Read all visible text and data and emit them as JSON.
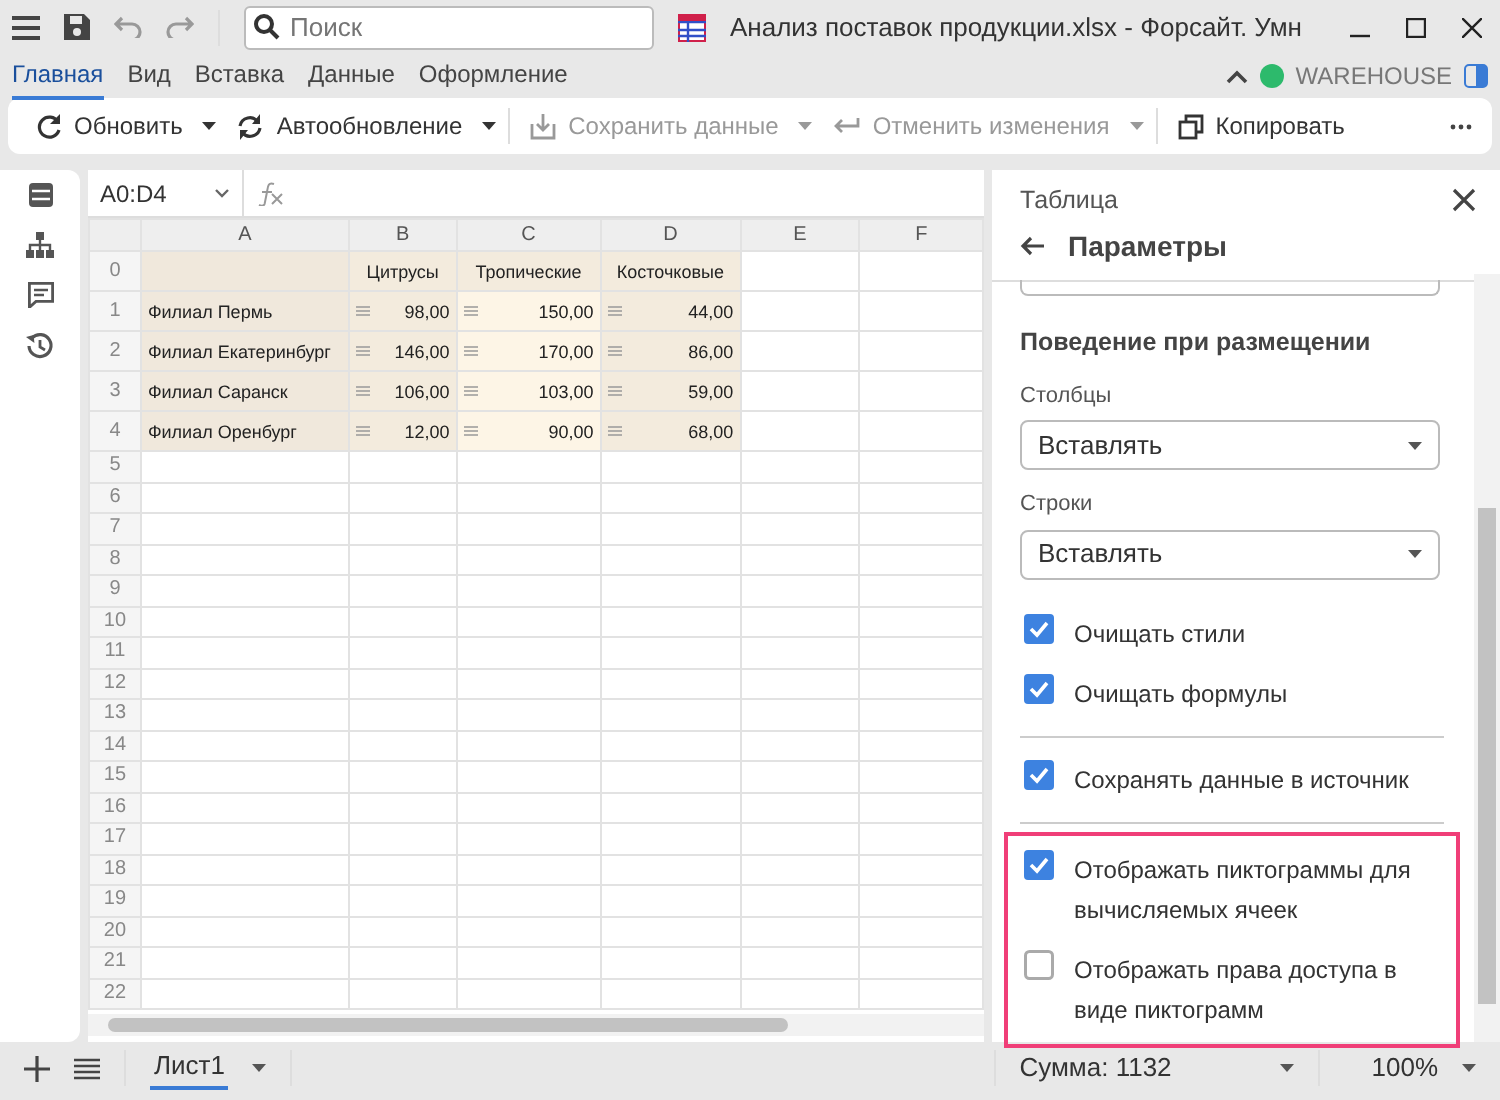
{
  "window": {
    "title": "Анализ поставок продукции.xlsx - Форсайт. Умн",
    "search_placeholder": "Поиск"
  },
  "ribbon_tabs": [
    {
      "label": "Главная",
      "selected": true
    },
    {
      "label": "Вид",
      "selected": false
    },
    {
      "label": "Вставка",
      "selected": false
    },
    {
      "label": "Данные",
      "selected": false
    },
    {
      "label": "Оформление",
      "selected": false
    }
  ],
  "connection": {
    "name": "WAREHOUSE",
    "color": "#2dba6c"
  },
  "toolbar": [
    {
      "kind": "refresh",
      "label": "Обновить",
      "dropdown": true,
      "disabled": false
    },
    {
      "kind": "autorefresh",
      "label": "Автообновление",
      "dropdown": true,
      "disabled": false
    },
    {
      "kind": "save",
      "label": "Сохранить данные",
      "dropdown": true,
      "disabled": true
    },
    {
      "kind": "undo",
      "label": "Отменить изменения",
      "dropdown": true,
      "disabled": true
    },
    {
      "kind": "copy",
      "label": "Копировать",
      "dropdown": false,
      "disabled": false
    }
  ],
  "formula_bar": {
    "cell_ref": "A0:D4"
  },
  "sheet": {
    "columns": [
      "A",
      "B",
      "C",
      "D",
      "E",
      "F"
    ],
    "row_numbers": [
      "0",
      "1",
      "2",
      "3",
      "4",
      "5",
      "6",
      "7",
      "8",
      "9",
      "10",
      "11",
      "12",
      "13",
      "14",
      "15",
      "16",
      "17",
      "18",
      "19",
      "20",
      "21",
      "22"
    ],
    "header": [
      "Цитрусы",
      "Тропические",
      "Косточковые"
    ],
    "rows": [
      [
        "Филиал Пермь",
        "98,00",
        "150,00",
        "44,00"
      ],
      [
        "Филиал Екатеринбург",
        "146,00",
        "170,00",
        "86,00"
      ],
      [
        "Филиал Саранск",
        "106,00",
        "103,00",
        "59,00"
      ],
      [
        "Филиал Оренбург",
        "12,00",
        "90,00",
        "68,00"
      ]
    ]
  },
  "panel": {
    "context": "Таблица",
    "title": "Параметры",
    "section": "Поведение при размещении",
    "selects": [
      {
        "label": "Столбцы",
        "value": "Вставлять"
      },
      {
        "label": "Строки",
        "value": "Вставлять"
      }
    ],
    "groups": [
      {
        "highlighted": false,
        "options": [
          {
            "label": "Очищать стили",
            "checked": true
          },
          {
            "label": "Очищать формулы",
            "checked": true
          }
        ]
      },
      {
        "highlighted": false,
        "options": [
          {
            "label": "Сохранять данные в источник",
            "checked": true
          }
        ]
      },
      {
        "highlighted": true,
        "options": [
          {
            "label": "Отображать пиктограммы для вычисляемых ячеек",
            "checked": true
          },
          {
            "label": "Отображать права доступа в виде пиктограмм",
            "checked": false
          }
        ]
      }
    ]
  },
  "status_bar": {
    "sheets": [
      {
        "label": "Лист1",
        "selected": true
      }
    ],
    "sum": "Сумма: 1132",
    "zoom": "100%"
  }
}
